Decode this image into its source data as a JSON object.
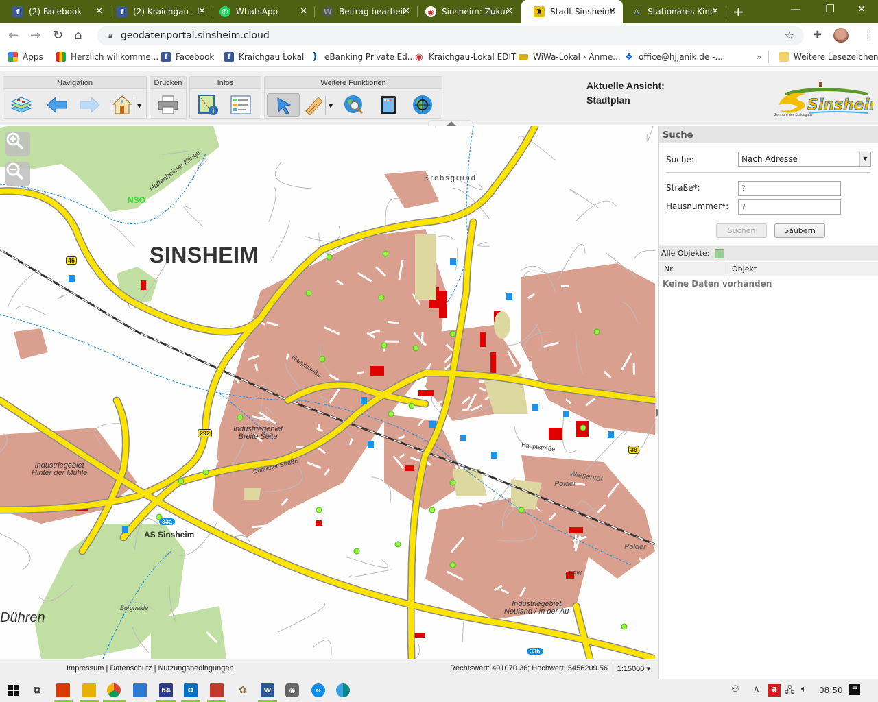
{
  "browser": {
    "tabs": [
      {
        "title": "(2) Facebook",
        "icon": "facebook-icon",
        "color": "#3b5998",
        "glyph": "f"
      },
      {
        "title": "(2) Kraichgau - L",
        "icon": "facebook-icon",
        "color": "#3b5998",
        "glyph": "f"
      },
      {
        "title": "WhatsApp",
        "icon": "whatsapp-icon",
        "color": "#25d366",
        "glyph": "✆"
      },
      {
        "title": "Beitrag bearbeit",
        "icon": "wordpress-icon",
        "color": "#666666",
        "glyph": "W"
      },
      {
        "title": "Sinsheim: Zukun",
        "icon": "eye-logo-icon",
        "color": "#cc2222",
        "glyph": "◉"
      },
      {
        "title": "Stadt Sinsheim:",
        "icon": "coat-of-arms-icon",
        "color": "#e6c200",
        "glyph": "♜",
        "active": true
      },
      {
        "title": "Stationäres Kind",
        "icon": "figure-icon",
        "color": "#3a6ea5",
        "glyph": "♙"
      }
    ],
    "close_glyph": "✕",
    "new_tab_glyph": "+",
    "url": "geodatenportal.sinsheim.cloud",
    "bookmarks": [
      {
        "label": "Apps",
        "icon": "apps-grid-icon",
        "color": "#e8710a"
      },
      {
        "label": "Herzlich willkomme...",
        "icon": "shop-bag-icon",
        "color": "#222222"
      },
      {
        "label": "Facebook",
        "icon": "facebook-icon",
        "color": "#3b5998"
      },
      {
        "label": "Kraichgau Lokal",
        "icon": "facebook-icon",
        "color": "#3b5998"
      },
      {
        "label": "eBanking Private Ed...",
        "icon": "bank-swoosh-icon",
        "color": "#0055a5"
      },
      {
        "label": "Kraichgau-Lokal EDIT",
        "icon": "eye-logo-icon",
        "color": "#cc2222"
      },
      {
        "label": "WiWa-Lokal › Anme...",
        "icon": "card-icon",
        "color": "#d8b000"
      },
      {
        "label": "office@hjjanik.de -...",
        "icon": "dropbox-icon",
        "color": "#0061fe"
      }
    ],
    "more_bookmarks": "»",
    "other_bookmarks": "Weitere Lesezeichen"
  },
  "app": {
    "toolbar_groups": [
      {
        "title": "Navigation",
        "buttons": [
          "layers",
          "back",
          "forward",
          "home"
        ]
      },
      {
        "title": "Drucken",
        "buttons": [
          "print"
        ]
      },
      {
        "title": "Infos",
        "buttons": [
          "map-info",
          "legend"
        ]
      },
      {
        "title": "Weitere Funktionen",
        "buttons": [
          "select-pointer",
          "measure-ruler",
          "search-globe",
          "tablet",
          "locate-globe"
        ]
      }
    ],
    "current_view_label": "Aktuelle Ansicht:",
    "current_view_value": "Stadtplan",
    "logo_text": "Sinsheim",
    "logo_tagline": "Zentrum des Kraichgaus"
  },
  "map": {
    "labels": {
      "city": "SINSHEIM",
      "district_duehren": "Dühren",
      "nsg": "NSG",
      "krebsgrund": "Krebsgrund",
      "as_sinsheim": "AS Sinsheim",
      "ind_hinter_muehle": "Industriegebiet\nHinter der Mühle",
      "ind_breite_seite": "Industriegebiet\nBreite Seite",
      "ind_neuland": "Industriegebiet\nNeuland / In der Au",
      "polder1": "Polder",
      "polder2": "Polder",
      "wiesental": "Wiesental",
      "burghalde": "Burghalde",
      "hoffenheimer_kling": "Hoffenheimer Klinge",
      "hauptstrasse": "Hauptstraße",
      "duehrener_strasse": "Dührener Straße",
      "route_45": "45",
      "route_292": "292",
      "route_39": "39",
      "exit_33a": "33a",
      "exit_33b": "33b",
      "tipw": "TIPW"
    }
  },
  "search_panel": {
    "title": "Suche",
    "search_label": "Suche:",
    "search_mode": "Nach Adresse",
    "street_label": "Straße*:",
    "street_value": "?",
    "housenumber_label": "Hausnummer*:",
    "housenumber_value": "?",
    "search_button": "Suchen",
    "clear_button": "Säubern",
    "all_objects_label": "Alle Objekte:",
    "columns": [
      "Nr.",
      "Objekt"
    ],
    "empty_text": "Keine Daten vorhanden"
  },
  "status": {
    "links": "Impressum | Datenschutz | Nutzungsbedingungen",
    "coords": "Rechtswert: 491070.36; Hochwert: 5456209.56",
    "scale": "1:15000 ▾"
  },
  "taskbar": {
    "time": "08:50",
    "apps": [
      {
        "name": "start",
        "color": "#111111"
      },
      {
        "name": "task-view",
        "color": "#333333"
      },
      {
        "name": "paint-app",
        "color": "#d83b01"
      },
      {
        "name": "file-explorer",
        "color": "#e8b100"
      },
      {
        "name": "chrome",
        "color": "#db4437"
      },
      {
        "name": "control-panel",
        "color": "#2b79d0"
      },
      {
        "name": "save-app",
        "color": "#2b3a8c"
      },
      {
        "name": "outlook",
        "color": "#0072c6"
      },
      {
        "name": "acrobat",
        "color": "#c0392b"
      },
      {
        "name": "gimp",
        "color": "#8a6a3a"
      },
      {
        "name": "word",
        "color": "#2b579a"
      },
      {
        "name": "camera",
        "color": "#666666"
      },
      {
        "name": "teamviewer",
        "color": "#0e8ee9"
      },
      {
        "name": "edge",
        "color": "#0c8a8a"
      }
    ]
  }
}
